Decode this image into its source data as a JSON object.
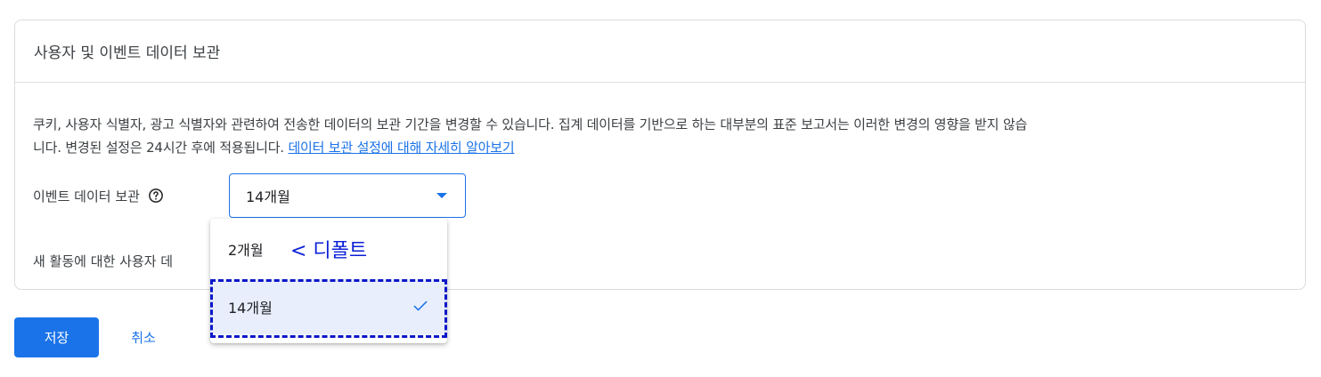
{
  "card": {
    "title": "사용자 및 이벤트 데이터 보관",
    "description_line1": "쿠키, 사용자 식별자, 광고 식별자와 관련하여 전송한 데이터의 보관 기간을 변경할 수 있습니다. 집계 데이터를 기반으로 하는 대부분의 표준 보고서는 이러한 변경의 영향을 받지 않습",
    "description_line2": "니다. 변경된 설정은 24시간 후에 적용됩니다. ",
    "learn_more_link": "데이터 보관 설정에 대해 자세히 알아보기"
  },
  "event_retention": {
    "label": "이벤트 데이터 보관",
    "help_icon": "help-circle-icon",
    "selected_value": "14개월",
    "options": [
      {
        "label": "2개월"
      },
      {
        "label": "14개월",
        "selected": true
      }
    ],
    "default_note": "< 디폴트"
  },
  "user_data": {
    "label_visible": "새 활동에 대한 사용자 데"
  },
  "actions": {
    "save_label": "저장",
    "cancel_label": "취소"
  },
  "colors": {
    "accent": "#1a73e8",
    "annotation": "#0b1fd6",
    "selected_bg": "#e8eefb"
  }
}
